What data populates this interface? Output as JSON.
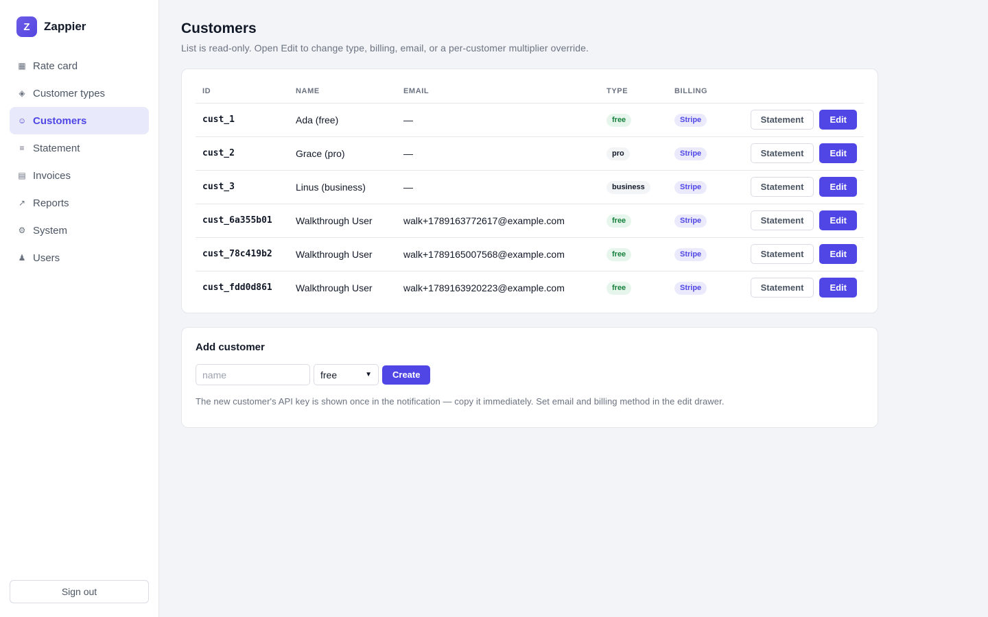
{
  "brand": {
    "logo_letter": "Z",
    "name": "Zappier",
    "accent": "#4f46e5"
  },
  "sidebar": {
    "items": [
      {
        "label": "Rate card",
        "icon": "grid-icon",
        "glyph": "▦",
        "active": false
      },
      {
        "label": "Customer types",
        "icon": "diamond-icon",
        "glyph": "◈",
        "active": false
      },
      {
        "label": "Customers",
        "icon": "smiley-icon",
        "glyph": "☺",
        "active": true
      },
      {
        "label": "Statement",
        "icon": "lines-icon",
        "glyph": "≡",
        "active": false
      },
      {
        "label": "Invoices",
        "icon": "invoice-icon",
        "glyph": "▤",
        "active": false
      },
      {
        "label": "Reports",
        "icon": "trend-icon",
        "glyph": "↗",
        "active": false
      },
      {
        "label": "System",
        "icon": "gear-icon",
        "glyph": "⚙",
        "active": false
      },
      {
        "label": "Users",
        "icon": "user-icon",
        "glyph": "♟",
        "active": false
      }
    ],
    "signout_label": "Sign out"
  },
  "page": {
    "title": "Customers",
    "subtitle": "List is read-only. Open Edit to change type, billing, email, or a per-customer multiplier override."
  },
  "table": {
    "headers": {
      "id": "ID",
      "name": "NAME",
      "email": "EMAIL",
      "type": "TYPE",
      "billing": "BILLING"
    },
    "statement_label": "Statement",
    "edit_label": "Edit",
    "rows": [
      {
        "id": "cust_1",
        "name": "Ada (free)",
        "email": "—",
        "type": "free",
        "billing": "Stripe"
      },
      {
        "id": "cust_2",
        "name": "Grace (pro)",
        "email": "—",
        "type": "pro",
        "billing": "Stripe"
      },
      {
        "id": "cust_3",
        "name": "Linus (business)",
        "email": "—",
        "type": "business",
        "billing": "Stripe"
      },
      {
        "id": "cust_6a355b01",
        "name": "Walkthrough User",
        "email": "walk+1789163772617@example.com",
        "type": "free",
        "billing": "Stripe"
      },
      {
        "id": "cust_78c419b2",
        "name": "Walkthrough User",
        "email": "walk+1789165007568@example.com",
        "type": "free",
        "billing": "Stripe"
      },
      {
        "id": "cust_fdd0d861",
        "name": "Walkthrough User",
        "email": "walk+1789163920223@example.com",
        "type": "free",
        "billing": "Stripe"
      }
    ]
  },
  "add_customer": {
    "title": "Add customer",
    "name_placeholder": "name",
    "name_value": "",
    "type_selected": "free",
    "create_label": "Create",
    "hint": "The new customer's API key is shown once in the notification — copy it immediately. Set email and billing method in the edit drawer."
  }
}
